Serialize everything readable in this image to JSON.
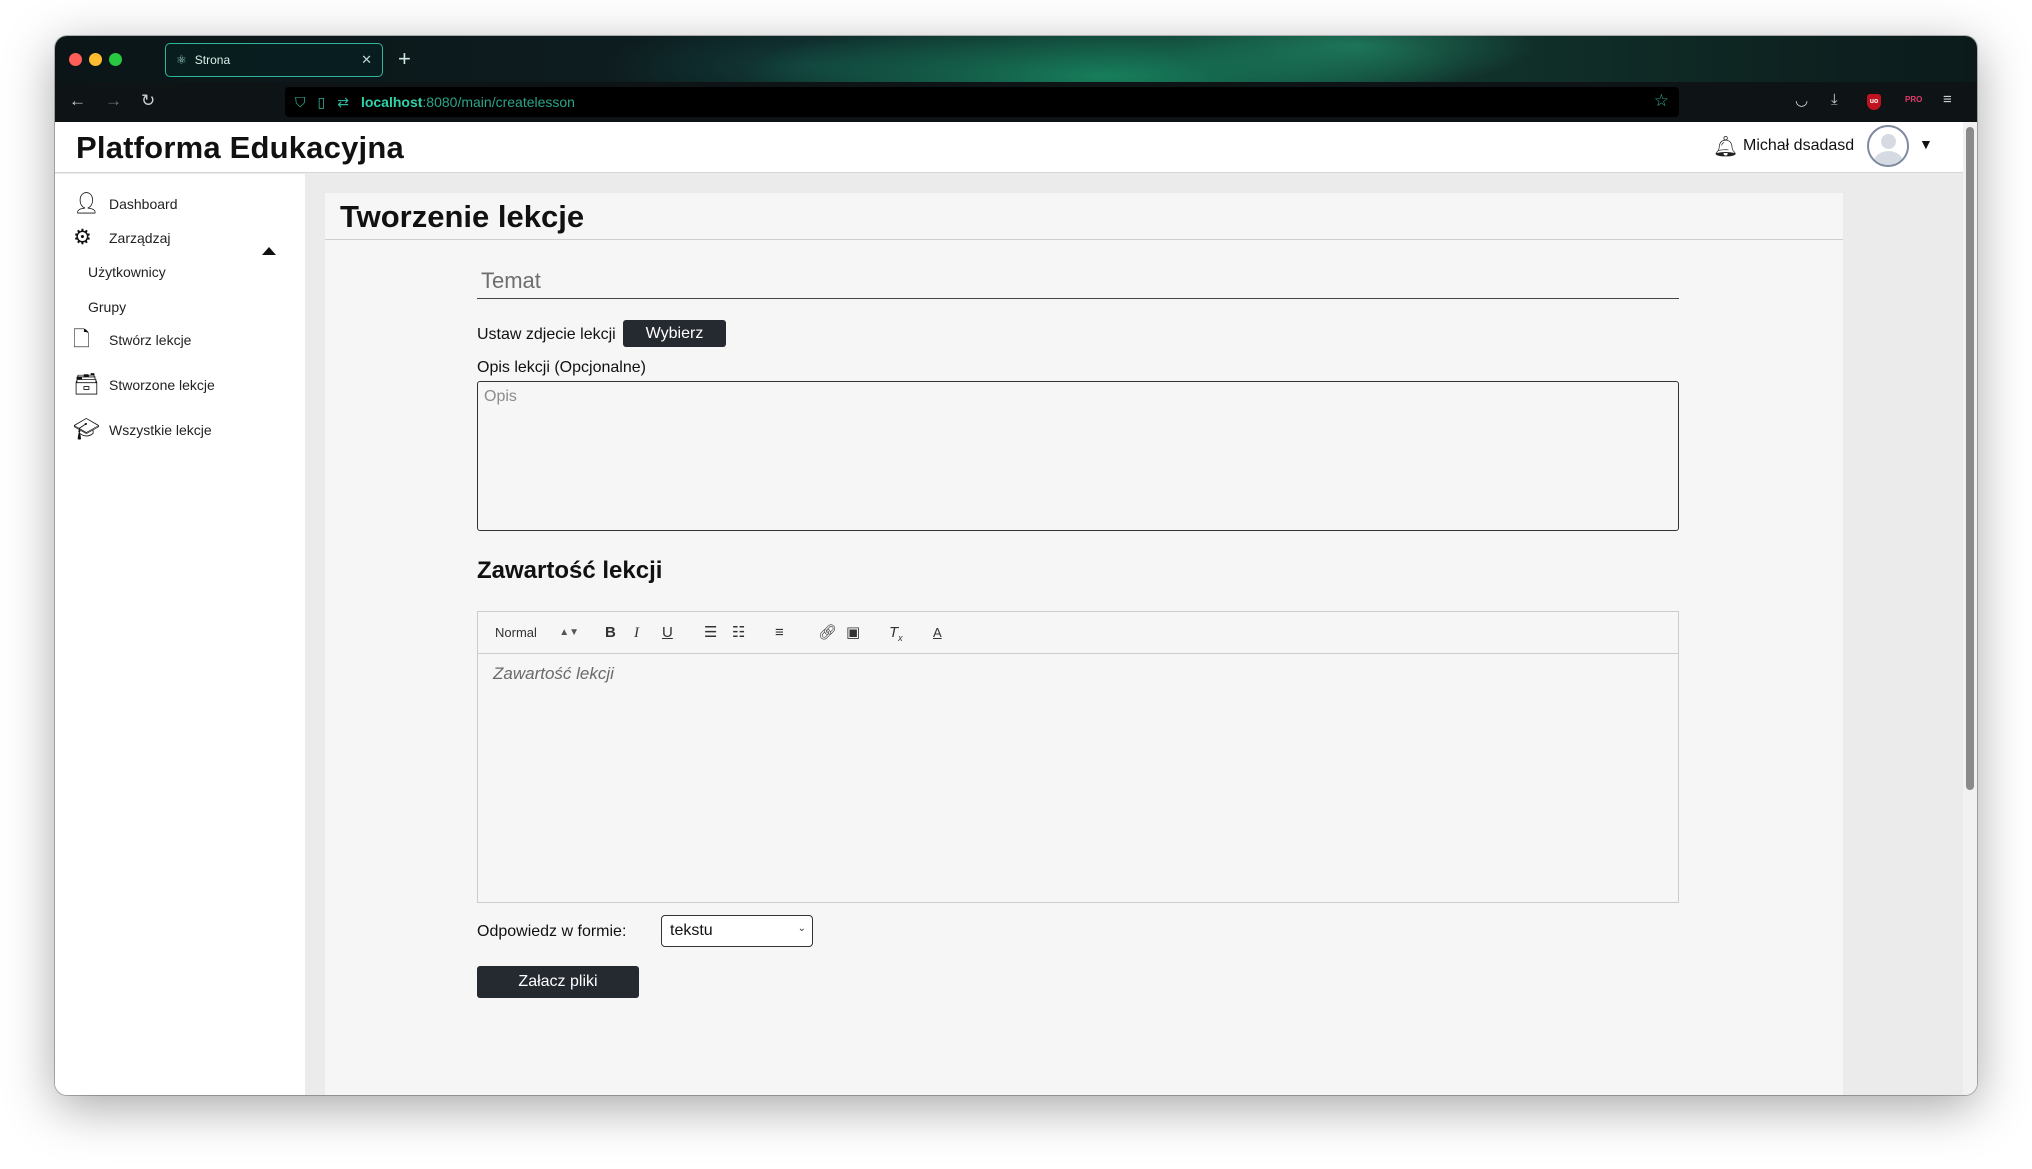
{
  "browser": {
    "tab_title": "Strona",
    "url_host": "localhost",
    "url_rest": ":8080/main/createlesson"
  },
  "app": {
    "brand": "Platforma Edukacyjna",
    "user_name": "Michał dsadasd"
  },
  "sidebar": {
    "items": [
      {
        "label": "Dashboard",
        "icon": "user-list-icon"
      },
      {
        "label": "Zarządzaj",
        "icon": "gear-icon"
      },
      {
        "label": "Stwórz lekcje",
        "icon": "file-plus-icon"
      },
      {
        "label": "Stworzone lekcje",
        "icon": "inbox-icon"
      },
      {
        "label": "Wszystkie lekcje",
        "icon": "graduation-cap-icon"
      }
    ],
    "subitems": [
      {
        "label": "Użytkownicy"
      },
      {
        "label": "Grupy"
      }
    ]
  },
  "form": {
    "page_title": "Tworzenie lekcje",
    "topic_placeholder": "Temat",
    "image_label": "Ustaw zdjecie lekcji",
    "image_button": "Wybierz",
    "description_label": "Opis lekcji (Opcjonalne)",
    "description_placeholder": "Opis",
    "content_title": "Zawartość lekcji",
    "editor_format": "Normal",
    "editor_placeholder": "Zawartość lekcji",
    "answer_label": "Odpowiedz w formie:",
    "answer_selected": "tekstu",
    "attach_button": "Załacz pliki"
  },
  "colors": {
    "button_dark": "#252a30",
    "accent_teal": "#2fd3a9"
  }
}
